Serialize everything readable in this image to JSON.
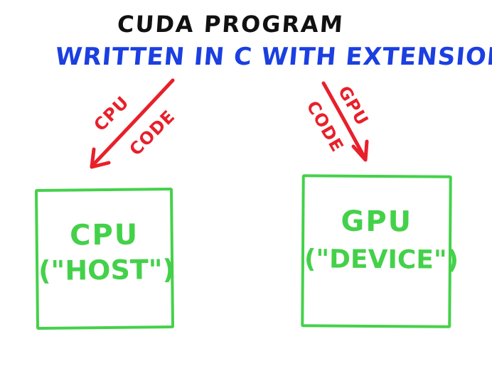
{
  "diagram": {
    "title": "CUDA PROGRAM",
    "subtitle": "WRITTEN IN C WITH EXTENSIONS",
    "left_arrow": {
      "label_top": "CPU",
      "label_bottom": "CODE"
    },
    "right_arrow": {
      "label_top": "GPU",
      "label_bottom": "CODE"
    },
    "host_box": {
      "title": "CPU",
      "subtitle": "(\"HOST\")"
    },
    "device_box": {
      "title": "GPU",
      "subtitle": "(\"DEVICE\")"
    }
  },
  "colors": {
    "title": "#111111",
    "subtitle": "#1b3fe0",
    "arrows": "#e8202a",
    "boxes": "#44d14a",
    "background": "#ffffff"
  }
}
